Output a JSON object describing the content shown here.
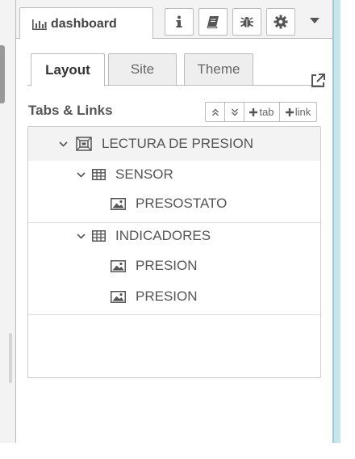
{
  "header": {
    "tab_label": "dashboard",
    "buttons": [
      "info-icon",
      "book-icon",
      "bug-icon",
      "gear-icon"
    ],
    "menu": "caret-down-icon"
  },
  "subtabs": {
    "layout": "Layout",
    "site": "Site",
    "theme": "Theme",
    "active": "Layout"
  },
  "section": {
    "title": "Tabs & Links",
    "tools": {
      "expand_all": "chevrons-up-icon",
      "collapse_all": "chevrons-down-icon",
      "add_tab": "tab",
      "add_link": "link"
    }
  },
  "tree": {
    "tab": {
      "label": "LECTURA DE PRESION",
      "icon": "tab-frame-icon"
    },
    "groups": [
      {
        "label": "SENSOR",
        "icon": "table-icon",
        "items": [
          {
            "label": "PRESOSTATO",
            "icon": "image-icon"
          }
        ]
      },
      {
        "label": "INDICADORES",
        "icon": "table-icon",
        "items": [
          {
            "label": "PRESION",
            "icon": "image-icon"
          },
          {
            "label": "PRESION",
            "icon": "image-icon"
          }
        ]
      }
    ]
  },
  "colors": {
    "panel_bg": "#f3f3f3",
    "border": "#bbbbbb",
    "text": "#555555",
    "accent_strip": "#c9e5ec"
  }
}
